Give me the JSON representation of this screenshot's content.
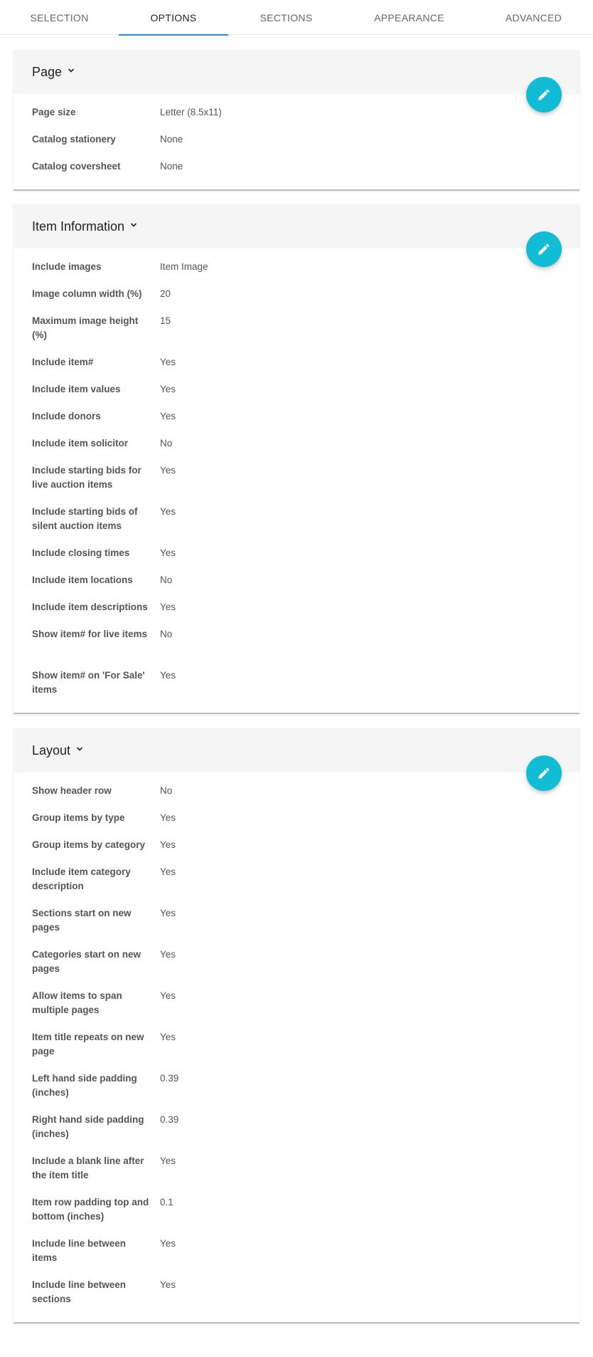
{
  "tabs": [
    {
      "label": "SELECTION",
      "active": false
    },
    {
      "label": "OPTIONS",
      "active": true
    },
    {
      "label": "SECTIONS",
      "active": false
    },
    {
      "label": "APPEARANCE",
      "active": false
    },
    {
      "label": "ADVANCED",
      "active": false
    }
  ],
  "accent_color": "#12bcd4",
  "tab_indicator_color": "#1e88e5",
  "sections": {
    "page": {
      "title": "Page",
      "rows": [
        {
          "label": "Page size",
          "value": "Letter (8.5x11)"
        },
        {
          "label": "Catalog stationery",
          "value": "None"
        },
        {
          "label": "Catalog coversheet",
          "value": "None"
        }
      ]
    },
    "item_information": {
      "title": "Item Information",
      "rows": [
        {
          "label": "Include images",
          "value": "Item Image"
        },
        {
          "label": "Image column width (%)",
          "value": "20"
        },
        {
          "label": "Maximum image height (%)",
          "value": "15"
        },
        {
          "label": "Include item#",
          "value": "Yes"
        },
        {
          "label": "Include item values",
          "value": "Yes"
        },
        {
          "label": "Include donors",
          "value": "Yes"
        },
        {
          "label": "Include item solicitor",
          "value": "No"
        },
        {
          "label": "Include starting bids for live auction items",
          "value": "Yes"
        },
        {
          "label": "Include starting bids of silent auction items",
          "value": "Yes"
        },
        {
          "label": "Include closing times",
          "value": "Yes"
        },
        {
          "label": "Include item locations",
          "value": "No"
        },
        {
          "label": "Include item descriptions",
          "value": "Yes"
        },
        {
          "label": "Show item# for live items",
          "value": "No"
        },
        {
          "label": "Show item# on 'For Sale' items",
          "value": "Yes"
        }
      ]
    },
    "layout": {
      "title": "Layout",
      "rows": [
        {
          "label": "Show header row",
          "value": "No"
        },
        {
          "label": "Group items by type",
          "value": "Yes"
        },
        {
          "label": "Group items by category",
          "value": "Yes"
        },
        {
          "label": "Include item category description",
          "value": "Yes"
        },
        {
          "label": "Sections start on new pages",
          "value": "Yes"
        },
        {
          "label": "Categories start on new pages",
          "value": "Yes"
        },
        {
          "label": "Allow items to span multiple pages",
          "value": "Yes"
        },
        {
          "label": "Item title repeats on new page",
          "value": "Yes"
        },
        {
          "label": "Left hand side padding (inches)",
          "value": "0.39"
        },
        {
          "label": "Right hand side padding (inches)",
          "value": "0.39"
        },
        {
          "label": "Include a blank line after the item title",
          "value": "Yes"
        },
        {
          "label": "Item row padding top and bottom (inches)",
          "value": "0.1"
        },
        {
          "label": "Include line between items",
          "value": "Yes"
        },
        {
          "label": "Include line between sections",
          "value": "Yes"
        }
      ]
    }
  }
}
